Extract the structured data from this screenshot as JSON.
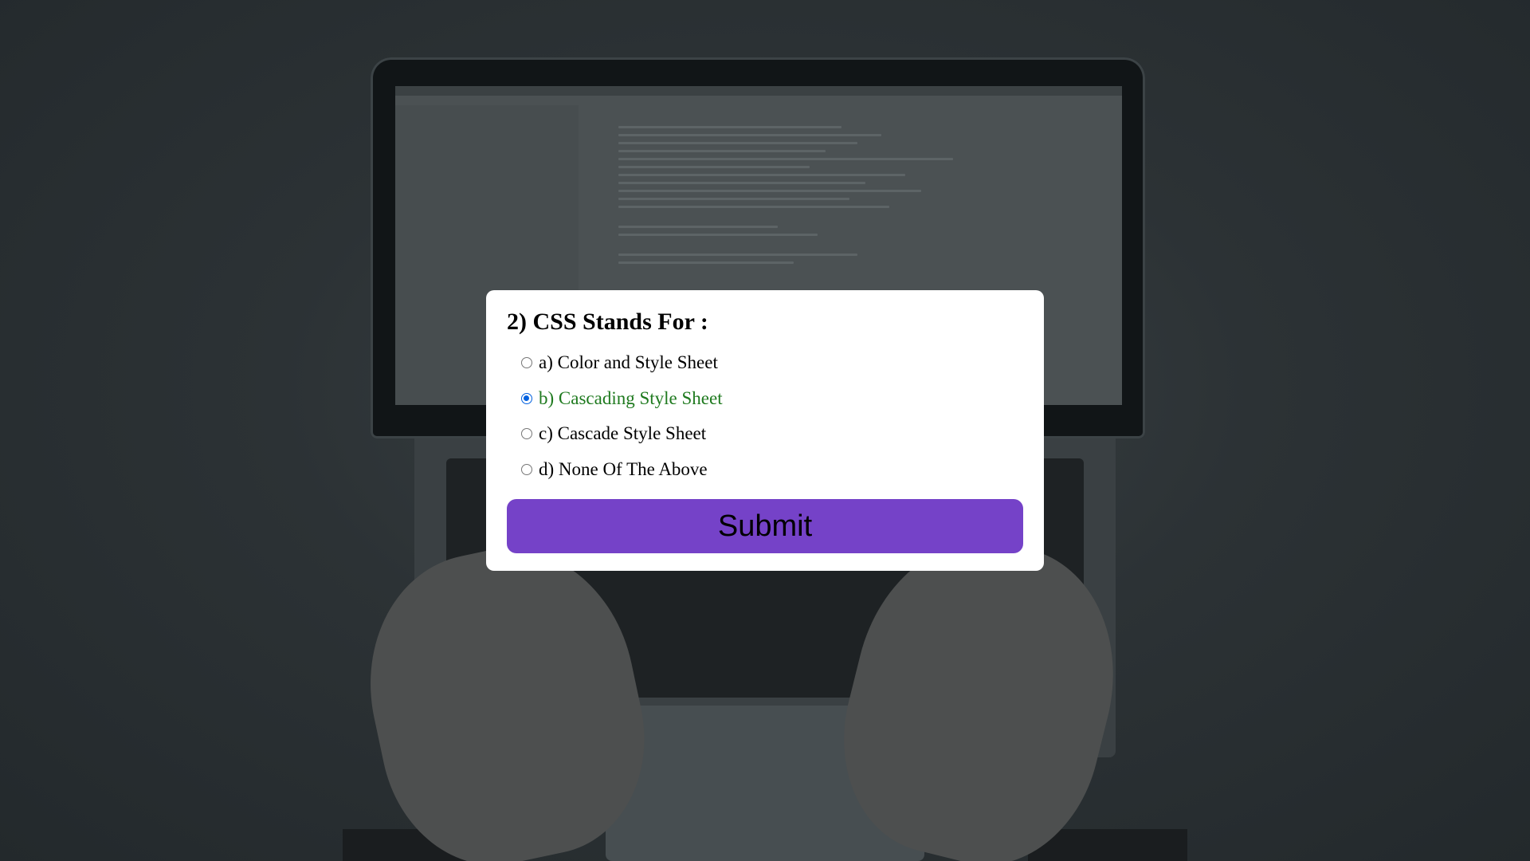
{
  "quiz": {
    "question": "2) CSS Stands For :",
    "options": [
      {
        "label": "a) Color and Style Sheet",
        "selected": false
      },
      {
        "label": "b) Cascading Style Sheet",
        "selected": true
      },
      {
        "label": "c) Cascade Style Sheet",
        "selected": false
      },
      {
        "label": "d) None Of The Above",
        "selected": false
      }
    ],
    "submit_label": "Submit"
  },
  "colors": {
    "button": "#7542c8",
    "selected_text": "#1f7a1f",
    "radio_checked": "#0060df",
    "card_background": "#ffffff"
  }
}
